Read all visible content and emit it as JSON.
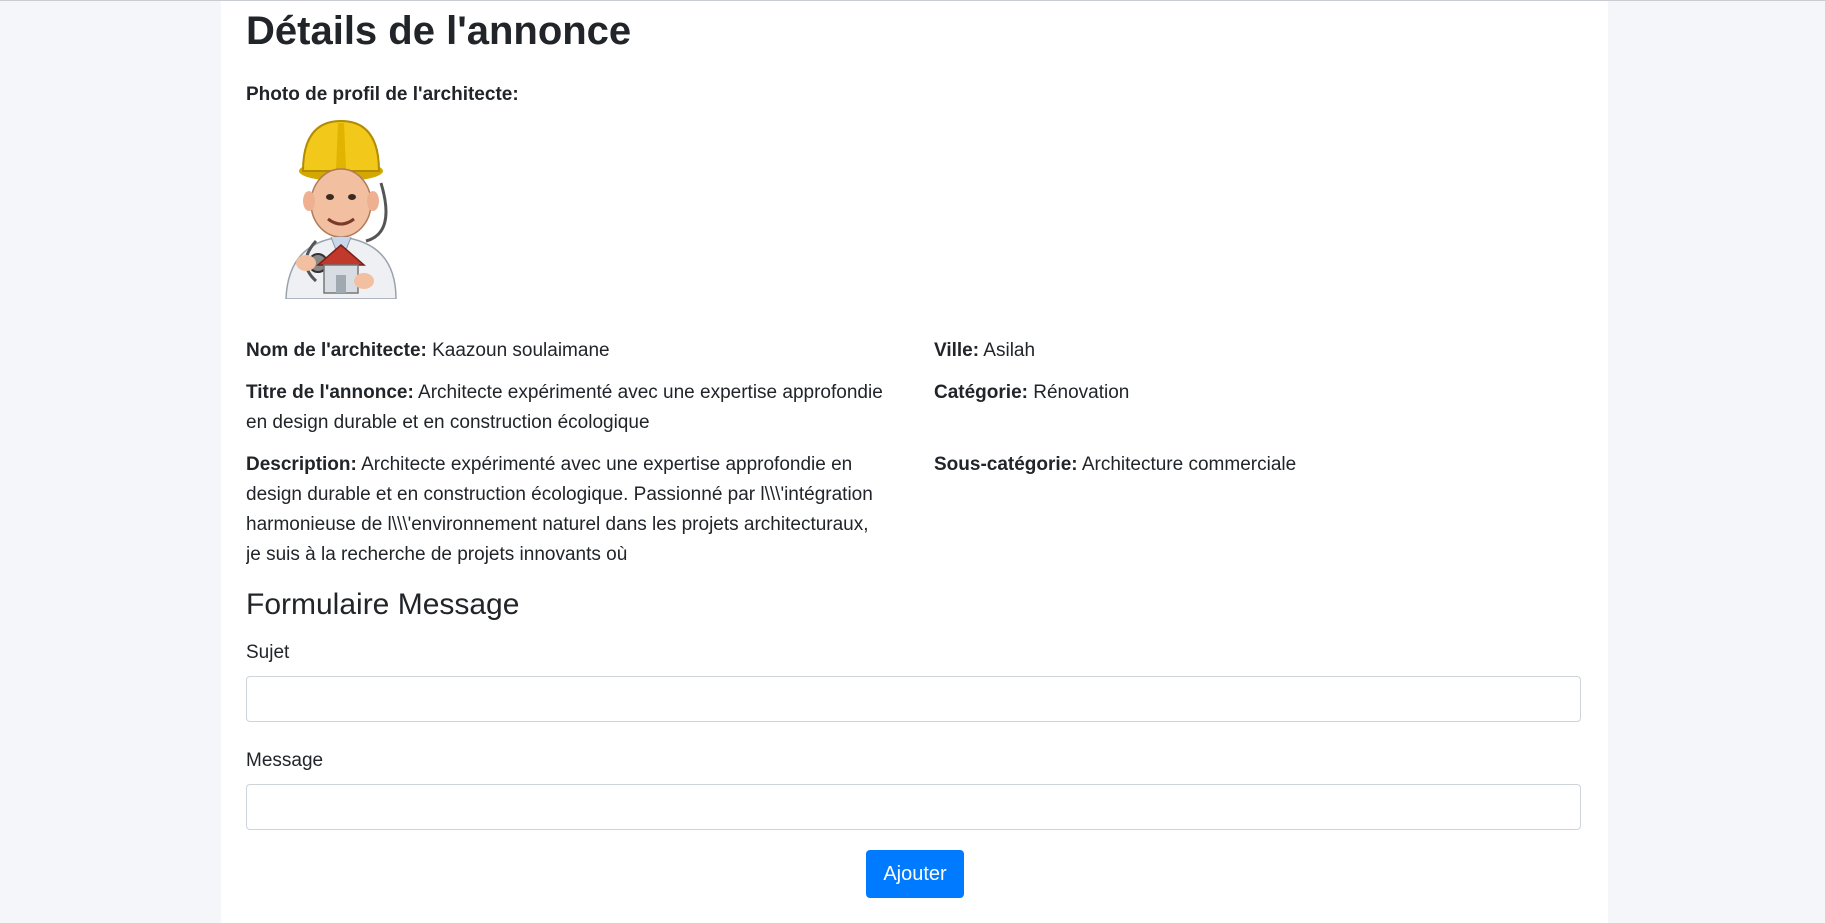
{
  "page": {
    "title": "Détails de l'annonce"
  },
  "profile": {
    "photo_label": "Photo de profil de l'architecte:",
    "photo_icon": "architect-cartoon-avatar"
  },
  "details": {
    "left": [
      {
        "label": "Nom de l'architecte:",
        "value": "Kaazoun soulaimane"
      },
      {
        "label": "Titre de l'annonce:",
        "value": "Architecte expérimenté avec une expertise approfondie en design durable et en construction écologique"
      },
      {
        "label": "Description:",
        "value": "Architecte expérimenté avec une expertise approfondie en design durable et en construction écologique. Passionné par l\\\\\\'intégration harmonieuse de l\\\\\\'environnement naturel dans les projets architecturaux, je suis à la recherche de projets innovants où"
      }
    ],
    "right": [
      {
        "label": "Ville:",
        "value": "Asilah"
      },
      {
        "label": "Catégorie:",
        "value": "Rénovation"
      },
      {
        "label": "Sous-catégorie:",
        "value": "Architecture commerciale"
      }
    ]
  },
  "form": {
    "title": "Formulaire Message",
    "subject_label": "Sujet",
    "subject_value": "",
    "message_label": "Message",
    "message_value": "",
    "submit_label": "Ajouter"
  },
  "colors": {
    "primary": "#007bff",
    "background": "#f4f6f9",
    "card": "#ffffff",
    "text": "#212529"
  }
}
